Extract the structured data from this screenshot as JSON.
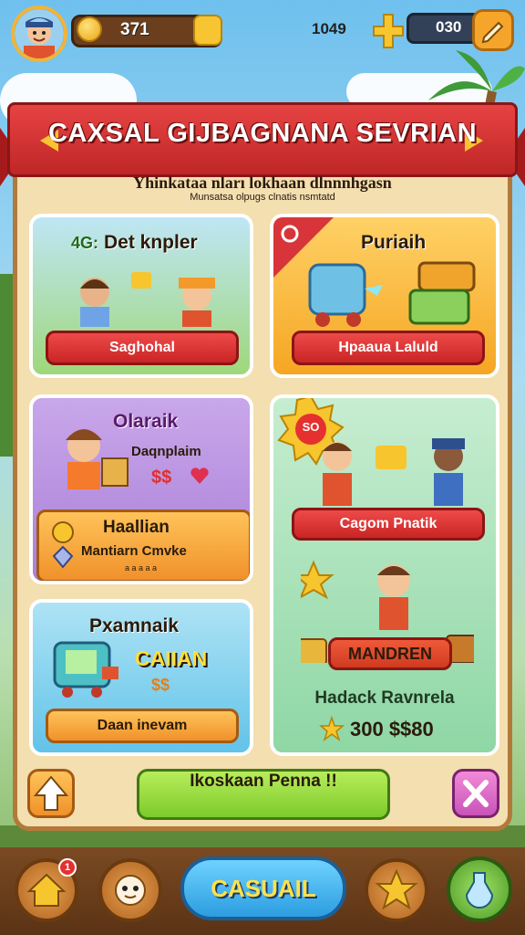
{
  "top_bar": {
    "coin_value": "371",
    "gem_value": "1049",
    "gem_bar_value": "030",
    "icons": [
      "avatar",
      "coin-icon",
      "plus-icon",
      "pencil-icon"
    ]
  },
  "title": "CAXSAL GIJBAGNANA SEVRIAN",
  "subtitle": "Yhinkataa nları lokhaan dlnnnhgasn",
  "subsubtitle": "Munsatsa olpugs clnatis nsmtatd",
  "cards": {
    "top_left": {
      "title": "Det knpler",
      "badge": "4G:",
      "button": "Saghohal"
    },
    "top_right": {
      "title": "Puriaih",
      "button": "Hpaaua Laluld"
    },
    "mid_left": {
      "title": "Olaraik",
      "caption": "Daqnplaim",
      "price": "$$",
      "sub_title": "Haallian",
      "sub_caption": "Mantiarn Cmvke",
      "sub_note": "a a a a a"
    },
    "right_tall": {
      "sticker": "SO",
      "button_top": "Cagom Pnatik",
      "ribbon": "MANDREN",
      "footer_title": "Hadack Ravnrela",
      "footer_value": "300 $$80"
    },
    "bottom_left": {
      "title": "Pxamnaik",
      "highlight": "CAIIAN",
      "price": "$$",
      "button": "Daan inevam"
    }
  },
  "footer_button": "Ikoskaan Penna !!",
  "nav": {
    "play_label": "CASUAIL",
    "home_badge": "1"
  },
  "colors": {
    "ribbon": "#d83030",
    "panel": "#f3dfb0",
    "play": "#2c9de0",
    "title_text": "#ffffff"
  }
}
